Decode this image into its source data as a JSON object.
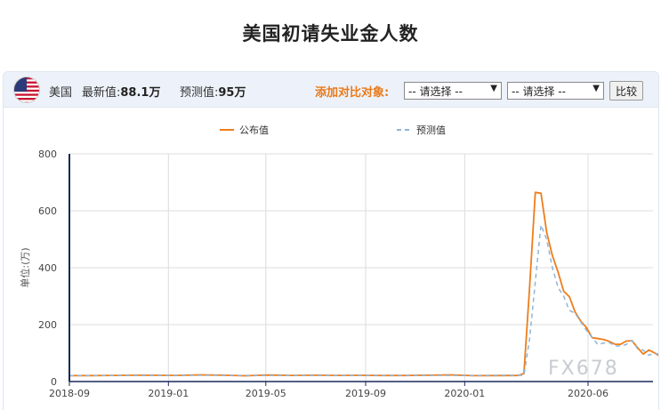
{
  "title": "美国初请失业金人数",
  "toolbar": {
    "country": "美国",
    "latest_label": "最新值:",
    "latest_value": "88.1万",
    "forecast_label": "预测值:",
    "forecast_value": "95万",
    "compare_label": "添加对比对象:",
    "select1": "-- 请选择 --",
    "select2": "-- 请选择 --",
    "compare_button": "比较",
    "flag_icon": "us-flag-icon"
  },
  "watermark": "FX678",
  "colors": {
    "actual": "#ef7d1a",
    "forecast": "#8fb5d8",
    "axis": "#1a2a5a",
    "grid": "#dcdcdc"
  },
  "chart_data": {
    "type": "line",
    "title": "",
    "xlabel": "",
    "ylabel": "单位:(万)",
    "ylim": [
      0,
      800
    ],
    "yticks": [
      0,
      200,
      400,
      600,
      800
    ],
    "xlim": [
      "2018-09-01",
      "2020-08-20"
    ],
    "xticks": [
      "2018-09",
      "2019-01",
      "2019-05",
      "2019-09",
      "2020-01",
      "2020-06"
    ],
    "grid": true,
    "legend_position": "top",
    "series": [
      {
        "name": "公布值",
        "style": "solid",
        "points": [
          [
            "2018-09-01",
            20.5
          ],
          [
            "2018-09-29",
            21.0
          ],
          [
            "2018-10-27",
            21.5
          ],
          [
            "2018-11-24",
            22.2
          ],
          [
            "2018-12-22",
            21.8
          ],
          [
            "2019-01-12",
            21.6
          ],
          [
            "2019-02-09",
            23.4
          ],
          [
            "2019-03-09",
            22.2
          ],
          [
            "2019-04-06",
            20.2
          ],
          [
            "2019-05-04",
            22.8
          ],
          [
            "2019-06-01",
            21.7
          ],
          [
            "2019-06-29",
            22.3
          ],
          [
            "2019-07-27",
            21.6
          ],
          [
            "2019-08-24",
            21.9
          ],
          [
            "2019-09-21",
            21.3
          ],
          [
            "2019-10-19",
            21.2
          ],
          [
            "2019-11-16",
            22.3
          ],
          [
            "2019-12-14",
            23.4
          ],
          [
            "2020-01-11",
            20.6
          ],
          [
            "2020-02-08",
            20.8
          ],
          [
            "2020-03-07",
            21.1
          ],
          [
            "2020-03-14",
            28.2
          ],
          [
            "2020-03-21",
            330.7
          ],
          [
            "2020-03-28",
            664.8
          ],
          [
            "2020-04-04",
            661.5
          ],
          [
            "2020-04-11",
            524.5
          ],
          [
            "2020-04-18",
            442.7
          ],
          [
            "2020-04-25",
            384.6
          ],
          [
            "2020-05-02",
            317.6
          ],
          [
            "2020-05-09",
            298.1
          ],
          [
            "2020-05-16",
            244.6
          ],
          [
            "2020-05-23",
            212.3
          ],
          [
            "2020-05-30",
            189.7
          ],
          [
            "2020-06-06",
            154.2
          ],
          [
            "2020-06-13",
            150.8
          ],
          [
            "2020-06-20",
            148.0
          ],
          [
            "2020-06-27",
            141.3
          ],
          [
            "2020-07-04",
            131.4
          ],
          [
            "2020-07-11",
            130.7
          ],
          [
            "2020-07-18",
            142.2
          ],
          [
            "2020-07-25",
            143.4
          ],
          [
            "2020-08-01",
            118.6
          ],
          [
            "2020-08-08",
            96.3
          ],
          [
            "2020-08-15",
            110.6
          ],
          [
            "2020-08-22",
            100.6
          ],
          [
            "2020-08-29",
            88.1
          ]
        ]
      },
      {
        "name": "预测值",
        "style": "dashed",
        "points": [
          [
            "2018-09-01",
            21.0
          ],
          [
            "2019-01-12",
            22.0
          ],
          [
            "2019-05-04",
            21.5
          ],
          [
            "2019-09-21",
            21.5
          ],
          [
            "2020-01-11",
            21.5
          ],
          [
            "2020-03-07",
            21.9
          ],
          [
            "2020-03-14",
            22.0
          ],
          [
            "2020-03-21",
            150.0
          ],
          [
            "2020-03-28",
            350.0
          ],
          [
            "2020-04-04",
            550.0
          ],
          [
            "2020-04-11",
            500.0
          ],
          [
            "2020-04-18",
            400.0
          ],
          [
            "2020-04-25",
            330.0
          ],
          [
            "2020-05-02",
            300.0
          ],
          [
            "2020-05-09",
            250.0
          ],
          [
            "2020-05-16",
            240.0
          ],
          [
            "2020-05-23",
            210.0
          ],
          [
            "2020-05-30",
            180.0
          ],
          [
            "2020-06-06",
            155.0
          ],
          [
            "2020-06-13",
            130.0
          ],
          [
            "2020-06-20",
            135.0
          ],
          [
            "2020-06-27",
            137.5
          ],
          [
            "2020-07-04",
            125.0
          ],
          [
            "2020-07-11",
            125.0
          ],
          [
            "2020-07-18",
            130.0
          ],
          [
            "2020-07-25",
            145.0
          ],
          [
            "2020-08-01",
            115.0
          ],
          [
            "2020-08-08",
            110.0
          ],
          [
            "2020-08-15",
            92.5
          ],
          [
            "2020-08-22",
            100.0
          ],
          [
            "2020-08-29",
            95.0
          ]
        ]
      }
    ]
  }
}
